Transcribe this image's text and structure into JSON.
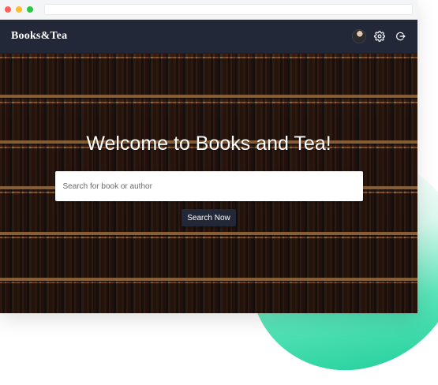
{
  "navbar": {
    "brand": "Books&Tea",
    "icons": [
      "avatar",
      "gear-icon",
      "logout-icon"
    ]
  },
  "hero": {
    "title": "Welcome to Books and Tea!",
    "search": {
      "placeholder": "Search for book or author",
      "value": ""
    },
    "search_button_label": "Search Now"
  },
  "colors": {
    "navbar": "#232838",
    "button": "#232838",
    "accent_blob": "#2dd3a1"
  }
}
